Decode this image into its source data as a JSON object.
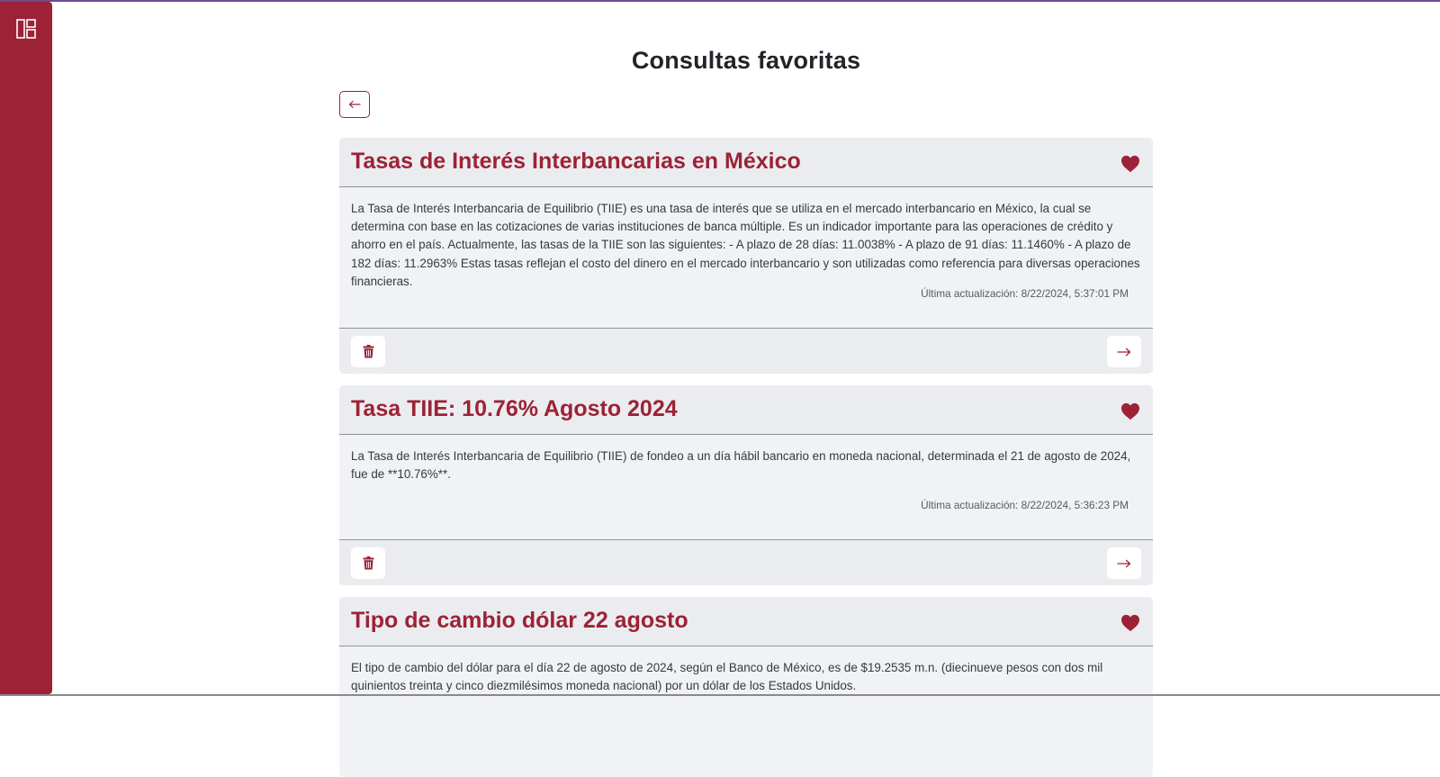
{
  "page": {
    "title": "Consultas favoritas"
  },
  "colors": {
    "brand": "#9d2235",
    "card_bg": "#f1f2f6",
    "header_bg": "#ebecf0"
  },
  "icons": {
    "sidebar_toggle": "layout-panels-icon",
    "back": "arrow-left-icon",
    "favorite": "heart-icon",
    "delete": "trash-icon",
    "open": "arrow-right-icon"
  },
  "favorites": [
    {
      "title": "Tasas de Interés Interbancarias en México",
      "text": "La Tasa de Interés Interbancaria de Equilibrio (TIIE) es una tasa de interés que se utiliza en el mercado interbancario en México, la cual se determina con base en las cotizaciones de varias instituciones de banca múltiple. Es un indicador importante para las operaciones de crédito y ahorro en el país. Actualmente, las tasas de la TIIE son las siguientes: - A plazo de 28 días: 11.0038% - A plazo de 91 días: 11.1460% - A plazo de 182 días: 11.2963% Estas tasas reflejan el costo del dinero en el mercado interbancario y son utilizadas como referencia para diversas operaciones financieras.",
      "updated": "Última actualización: 8/22/2024, 5:37:01 PM"
    },
    {
      "title": "Tasa TIIE: 10.76% Agosto 2024",
      "text": "La Tasa de Interés Interbancaria de Equilibrio (TIIE) de fondeo a un día hábil bancario en moneda nacional, determinada el 21 de agosto de 2024, fue de **10.76%**.",
      "updated": "Última actualización: 8/22/2024, 5:36:23 PM"
    },
    {
      "title": "Tipo de cambio dólar 22 agosto",
      "text": "El tipo de cambio del dólar para el día 22 de agosto de 2024, según el Banco de México, es de $19.2535 m.n. (diecinueve pesos con dos mil quinientos treinta y cinco diezmilésimos moneda nacional) por un dólar de los Estados Unidos."
    }
  ]
}
